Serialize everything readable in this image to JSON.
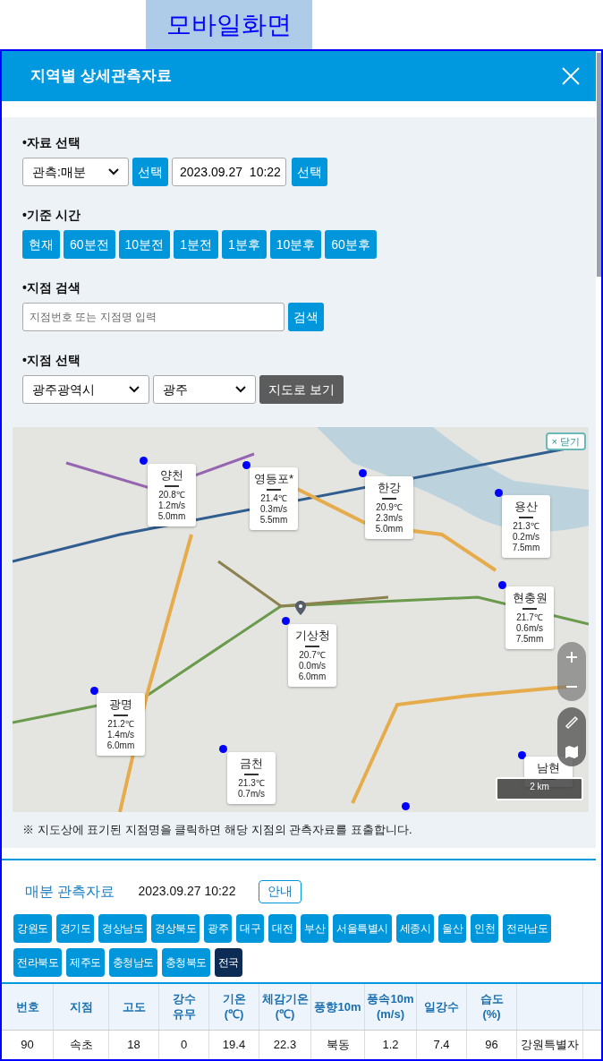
{
  "page_label": "모바일화면",
  "dialog": {
    "title": "지역별 상세관측자료"
  },
  "filters": {
    "data_select": {
      "label": "•자료 선택",
      "dropdown": "관측:매분",
      "select_button": "선택",
      "datetime": "2023.09.27  10:22",
      "datetime_button": "선택"
    },
    "base_time": {
      "label": "•기준 시간",
      "buttons": [
        "현재",
        "60분전",
        "10분전",
        "1분전",
        "1분후",
        "10분후",
        "60분후"
      ]
    },
    "station_search": {
      "label": "•지점 검색",
      "placeholder": "지점번호 또는 지점명 입력",
      "button": "검색"
    },
    "station_select": {
      "label": "•지점 선택",
      "region": "광주광역시",
      "station": "광주",
      "map_button": "지도로 보기"
    }
  },
  "map": {
    "close_button": "× 닫기",
    "scale": "2 km",
    "stations": [
      {
        "name": "양천",
        "readings": [
          "20.8℃",
          "1.2m/s",
          "5.0mm"
        ]
      },
      {
        "name": "영등포*",
        "readings": [
          "21.4℃",
          "0.3m/s",
          "5.5mm"
        ]
      },
      {
        "name": "한강",
        "readings": [
          "20.9℃",
          "2.3m/s",
          "5.0mm"
        ]
      },
      {
        "name": "용산",
        "readings": [
          "21.3℃",
          "0.2m/s",
          "7.5mm"
        ]
      },
      {
        "name": "현충원",
        "readings": [
          "21.7℃",
          "0.6m/s",
          "7.5mm"
        ]
      },
      {
        "name": "기상청",
        "readings": [
          "20.7℃",
          "0.0m/s",
          "6.0mm"
        ]
      },
      {
        "name": "광명",
        "readings": [
          "21.2℃",
          "1.4m/s",
          "6.0mm"
        ]
      },
      {
        "name": "금천",
        "readings": [
          "21.3℃",
          "0.7m/s"
        ]
      },
      {
        "name": "남현"
      }
    ],
    "note": "※ 지도상에 표기된 지점명을 클릭하면 해당 지점의 관측자료를 표출합니다."
  },
  "results": {
    "title": "매분 관측자료",
    "datetime": "2023.09.27 10:22",
    "info_button": "안내",
    "regions": [
      {
        "label": "강원도",
        "selected": false
      },
      {
        "label": "경기도",
        "selected": false
      },
      {
        "label": "경상남도",
        "selected": false
      },
      {
        "label": "경상북도",
        "selected": false
      },
      {
        "label": "광주",
        "selected": false
      },
      {
        "label": "대구",
        "selected": false
      },
      {
        "label": "대전",
        "selected": false
      },
      {
        "label": "부산",
        "selected": false
      },
      {
        "label": "서울특별시",
        "selected": false
      },
      {
        "label": "세종시",
        "selected": false
      },
      {
        "label": "울산",
        "selected": false
      },
      {
        "label": "인천",
        "selected": false
      },
      {
        "label": "전라남도",
        "selected": false
      },
      {
        "label": "전라북도",
        "selected": false
      },
      {
        "label": "제주도",
        "selected": false
      },
      {
        "label": "충청남도",
        "selected": false
      },
      {
        "label": "충청북도",
        "selected": false
      },
      {
        "label": "전국",
        "selected": true
      }
    ],
    "table": {
      "columns": [
        "번호",
        "지점",
        "고도",
        "강수\n유무",
        "기온\n(℃)",
        "체감기온\n(℃)",
        "풍향10m",
        "풍속10m\n(m/s)",
        "일강수",
        "습도\n(%)"
      ],
      "rows": [
        [
          "90",
          "속초",
          "18",
          "0",
          "19.4",
          "22.3",
          "북동",
          "1.2",
          "7.4",
          "96",
          "강원특별자"
        ]
      ]
    }
  }
}
